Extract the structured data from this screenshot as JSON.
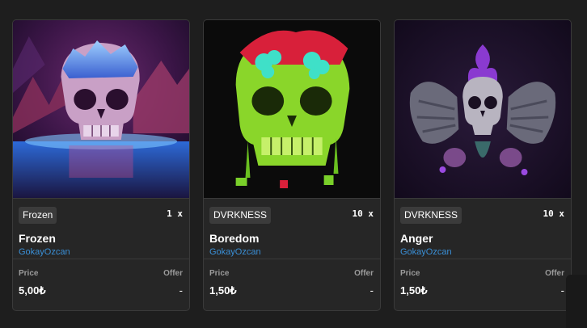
{
  "cards": [
    {
      "collection": "Frozen",
      "quantity": "1 x",
      "title": "Frozen",
      "creator": "GokayOzcan",
      "price_label": "Price",
      "offer_label": "Offer",
      "price": "5,00₺",
      "offer": "-",
      "art": "frozen-skull-image"
    },
    {
      "collection": "DVRKNESS",
      "quantity": "10 x",
      "title": "Boredom",
      "creator": "GokayOzcan",
      "price_label": "Price",
      "offer_label": "Offer",
      "price": "1,50₺",
      "offer": "-",
      "art": "green-skull-image"
    },
    {
      "collection": "DVRKNESS",
      "quantity": "10 x",
      "title": "Anger",
      "creator": "GokayOzcan",
      "price_label": "Price",
      "offer_label": "Offer",
      "price": "1,50₺",
      "offer": "-",
      "art": "winged-skull-image"
    }
  ],
  "colors": {
    "background": "#1e1e1e",
    "card": "#262626",
    "link": "#3a8fd6"
  }
}
